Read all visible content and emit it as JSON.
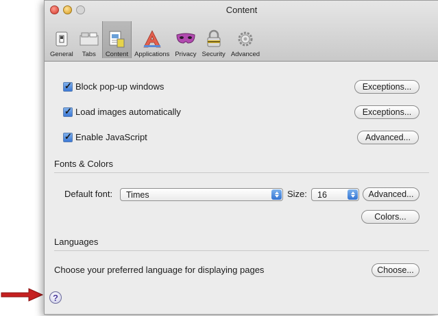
{
  "window": {
    "title": "Content"
  },
  "toolbar": {
    "items": [
      {
        "label": "General",
        "icon": "general-switch-icon",
        "selected": false
      },
      {
        "label": "Tabs",
        "icon": "tabs-icon",
        "selected": false
      },
      {
        "label": "Content",
        "icon": "content-document-icon",
        "selected": true
      },
      {
        "label": "Applications",
        "icon": "applications-a-icon",
        "selected": false
      },
      {
        "label": "Privacy",
        "icon": "privacy-mask-icon",
        "selected": false
      },
      {
        "label": "Security",
        "icon": "security-lock-icon",
        "selected": false
      },
      {
        "label": "Advanced",
        "icon": "advanced-gear-icon",
        "selected": false
      }
    ]
  },
  "options": {
    "block_popups": {
      "label": "Block pop-up windows",
      "checked": true,
      "button": "Exceptions..."
    },
    "load_images": {
      "label": "Load images automatically",
      "checked": true,
      "button": "Exceptions..."
    },
    "javascript": {
      "label": "Enable JavaScript",
      "checked": true,
      "button": "Advanced..."
    }
  },
  "fonts": {
    "heading": "Fonts & Colors",
    "default_font_label": "Default font:",
    "default_font_value": "Times",
    "size_label": "Size:",
    "size_value": "16",
    "advanced_button": "Advanced...",
    "colors_button": "Colors..."
  },
  "languages": {
    "heading": "Languages",
    "description": "Choose your preferred language for displaying pages",
    "choose_button": "Choose..."
  },
  "help": {
    "label": "?"
  },
  "colors": {
    "accent": "#3b78d6",
    "arrow": "#c62020"
  }
}
